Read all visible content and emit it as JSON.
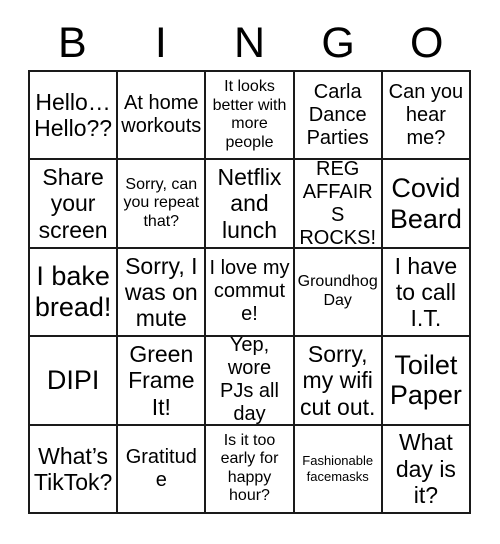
{
  "card": {
    "title": "BINGO",
    "header_letters": [
      "B",
      "I",
      "N",
      "G",
      "O"
    ],
    "grid_size": "5x5",
    "colors": {
      "border": "#1a1a1a",
      "background": "#ffffff",
      "text": "#000000"
    },
    "cells": [
      {
        "text": "Hello… Hello??",
        "size": "lg"
      },
      {
        "text": "At home workouts",
        "size": "md"
      },
      {
        "text": "It looks better with more people",
        "size": "sm"
      },
      {
        "text": "Carla Dance Parties",
        "size": "md"
      },
      {
        "text": "Can you hear me?",
        "size": "md"
      },
      {
        "text": "Share your screen",
        "size": "lg"
      },
      {
        "text": "Sorry, can you repeat that?",
        "size": "sm"
      },
      {
        "text": "Netflix and lunch",
        "size": "lg"
      },
      {
        "text": "REG AFFAIRS ROCKS!",
        "size": "md"
      },
      {
        "text": "Covid Beard",
        "size": "xl"
      },
      {
        "text": "I bake bread!",
        "size": "xl"
      },
      {
        "text": "Sorry, I was on mute",
        "size": "lg"
      },
      {
        "text": "I love my commute!",
        "size": "md"
      },
      {
        "text": "Groundhog Day",
        "size": "sm"
      },
      {
        "text": "I have to call I.T.",
        "size": "lg"
      },
      {
        "text": "DIPI",
        "size": "xl"
      },
      {
        "text": "Green Frame It!",
        "size": "lg"
      },
      {
        "text": "Yep, wore PJs all day",
        "size": "md"
      },
      {
        "text": "Sorry, my wifi cut out.",
        "size": "lg"
      },
      {
        "text": "Toilet Paper",
        "size": "xl"
      },
      {
        "text": "What’s TikTok?",
        "size": "lg"
      },
      {
        "text": "Gratitude",
        "size": "md"
      },
      {
        "text": "Is it too early for happy hour?",
        "size": "sm"
      },
      {
        "text": "Fashionable facemasks",
        "size": "xs"
      },
      {
        "text": "What day is it?",
        "size": "lg"
      }
    ]
  }
}
